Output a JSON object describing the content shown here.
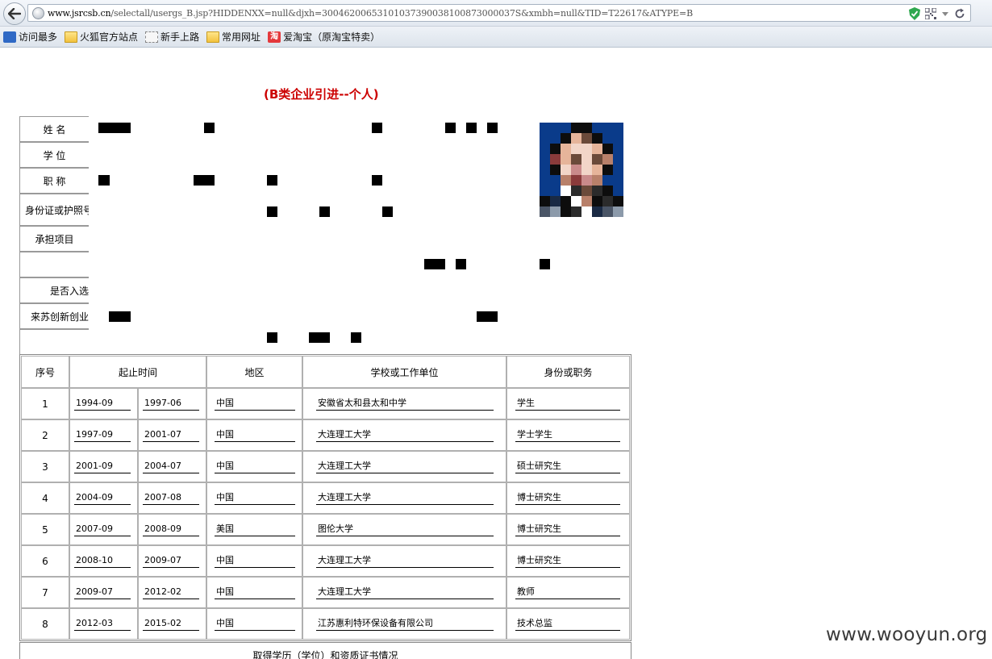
{
  "browser": {
    "url_host": "www.jsrcsb.cn",
    "url_path": "/selectall/usergs_B.jsp?HIDDENXX=null&djxh=30046200653101037390038100873000037S&xmbh=null&TID=T22617&ATYPE=B",
    "icons": [
      "back-arrow-icon",
      "globe-icon",
      "shield-icon",
      "qr-code-icon",
      "dropdown-icon",
      "reload-icon"
    ]
  },
  "bookmarks": [
    {
      "label": "访问最多",
      "icon": "most-visited-icon"
    },
    {
      "label": "火狐官方站点",
      "icon": "folder-icon"
    },
    {
      "label": "新手上路",
      "icon": "new-page-icon"
    },
    {
      "label": "常用网址",
      "icon": "folder-icon"
    },
    {
      "label": "爱淘宝（原淘宝特卖）",
      "icon": "taobao-icon",
      "icon_text": "淘"
    }
  ],
  "page": {
    "title": "(B类企业引进--个人)",
    "title_color": "#cc0000"
  },
  "form_labels": [
    "姓 名",
    "学 位",
    "职 称",
    "身份证或护照号",
    "承担项目",
    "",
    "是否入选",
    "来苏创新创业",
    ""
  ],
  "education": {
    "headers": [
      "序号",
      "起止时间",
      "地区",
      "学校或工作单位",
      "身份或职务"
    ],
    "rows": [
      {
        "no": "1",
        "start": "1994-09",
        "end": "1997-06",
        "area": "中国",
        "school": "安徽省太和县太和中学",
        "role": "学生"
      },
      {
        "no": "2",
        "start": "1997-09",
        "end": "2001-07",
        "area": "中国",
        "school": "大连理工大学",
        "role": "学士学生"
      },
      {
        "no": "3",
        "start": "2001-09",
        "end": "2004-07",
        "area": "中国",
        "school": "大连理工大学",
        "role": "硕士研究生"
      },
      {
        "no": "4",
        "start": "2004-09",
        "end": "2007-08",
        "area": "中国",
        "school": "大连理工大学",
        "role": "博士研究生"
      },
      {
        "no": "5",
        "start": "2007-09",
        "end": "2008-09",
        "area": "美国",
        "school": "图伦大学",
        "role": "博士研究生"
      },
      {
        "no": "6",
        "start": "2008-10",
        "end": "2009-07",
        "area": "中国",
        "school": "大连理工大学",
        "role": "博士研究生"
      },
      {
        "no": "7",
        "start": "2009-07",
        "end": "2012-02",
        "area": "中国",
        "school": "大连理工大学",
        "role": "教师"
      },
      {
        "no": "8",
        "start": "2012-03",
        "end": "2015-02",
        "area": "中国",
        "school": "江苏惠利特环保设备有限公司",
        "role": "技术总监"
      }
    ]
  },
  "footer_section": "取得学历（学位）和资质证书情况",
  "watermark": "www.wooyun.org"
}
